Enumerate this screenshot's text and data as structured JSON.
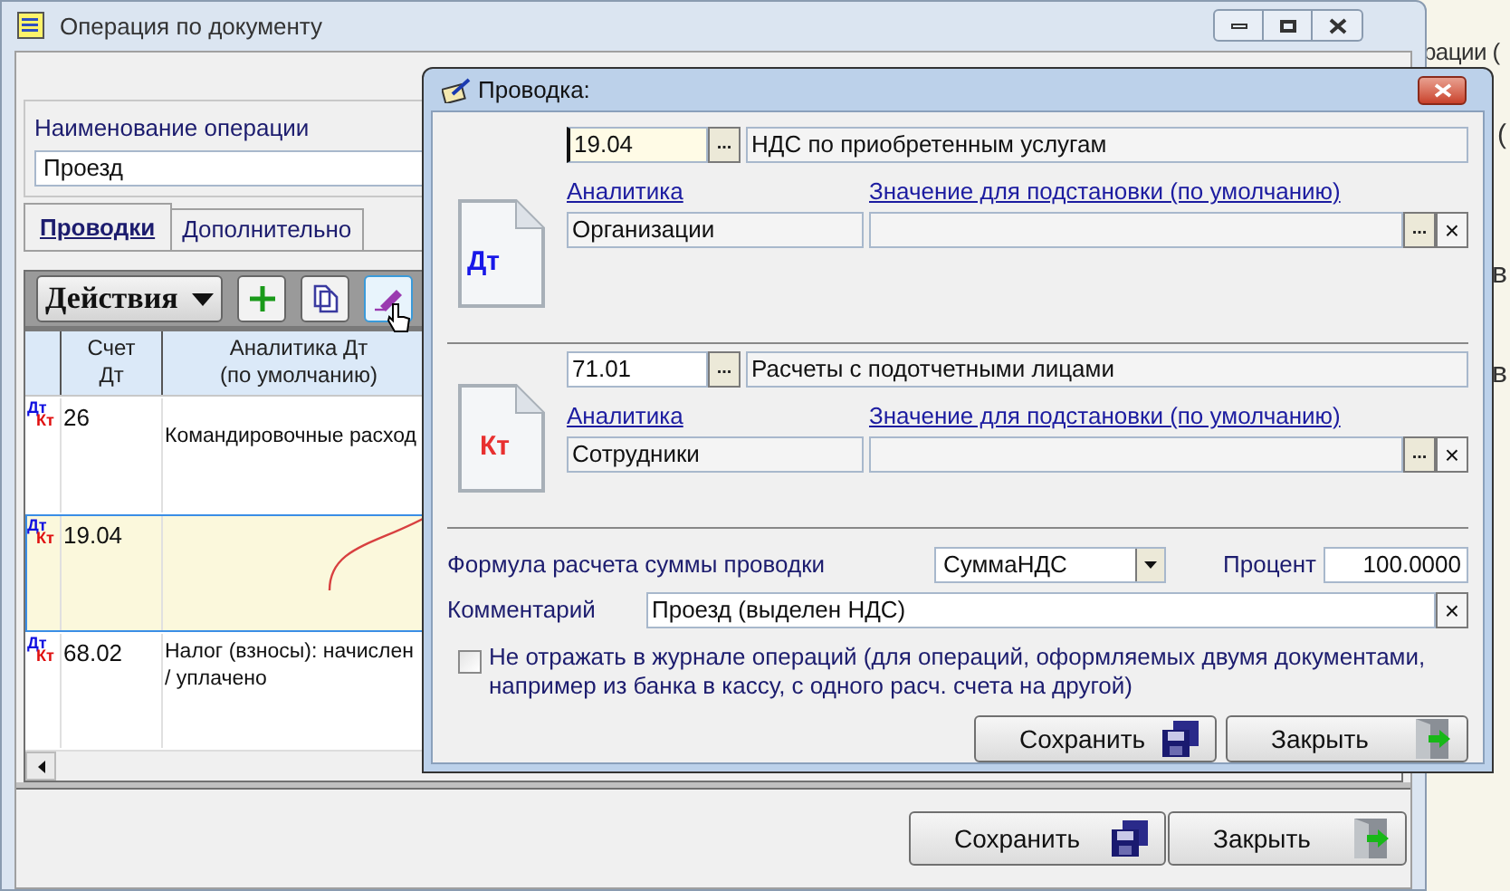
{
  "background_texts": [
    "рации (",
    "(",
    "в",
    "в"
  ],
  "main_window": {
    "title": "Операция по документу",
    "operation_name": {
      "label": "Наименование операции",
      "value": "Проезд"
    },
    "tabs": [
      {
        "label": "Проводки",
        "selected": true
      },
      {
        "label": "Дополнительно",
        "selected": false
      }
    ],
    "actions_button": "Действия",
    "table": {
      "columns": [
        "Счет\nДт",
        "Аналитика Дт\n(по умолчанию)"
      ],
      "rows": [
        {
          "dt": "Дт",
          "kt": "Кт",
          "account": "26",
          "analytics": "Командировочные расход",
          "selected": false
        },
        {
          "dt": "Дт",
          "kt": "Кт",
          "account": "19.04",
          "selected": true
        },
        {
          "dt": "Дт",
          "kt": "Кт",
          "account": "68.02",
          "analytics": "Налог (взносы): начислен\n/ уплачено",
          "selected": false
        }
      ]
    },
    "buttons": [
      "Сохранить",
      "Закрыть"
    ]
  },
  "dialog": {
    "title": "Проводка:",
    "entries": [
      {
        "kind": "debit",
        "badge": "Дт",
        "account": "19.04",
        "focused": true,
        "browse": "...",
        "account_name": "НДС по приобретенным услугам",
        "analytics_link": "Аналитика",
        "value_link": "Значение для подстановки (по умолчанию)",
        "analytics": "Организации",
        "value_browse": "...",
        "value_clear": "×"
      },
      {
        "kind": "credit",
        "badge": "Кт",
        "account": "71.01",
        "focused": false,
        "browse": "...",
        "account_name": "Расчеты с подотчетными лицами",
        "analytics_link": "Аналитика",
        "value_link": "Значение для подстановки (по умолчанию)",
        "analytics": "Сотрудники",
        "value_browse": "...",
        "value_clear": "×"
      }
    ],
    "formula": {
      "label": "Формула расчета суммы проводки",
      "value": "СуммаНДС",
      "percent_label": "Процент",
      "percent": "100.0000"
    },
    "comment": {
      "label": "Комментарий",
      "value": "Проезд (выделен НДС)",
      "clear": "×"
    },
    "checkbox": {
      "label": "Не отражать в журнале операций (для операций, оформляемых двумя документами, например из банка в кассу, с одного расч. счета на другой)",
      "checked": false
    },
    "buttons": [
      "Сохранить",
      "Закрыть"
    ]
  }
}
